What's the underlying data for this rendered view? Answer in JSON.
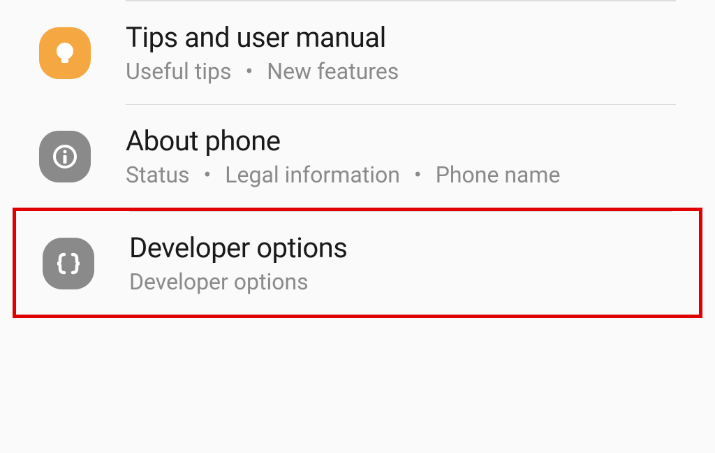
{
  "items": [
    {
      "title": "Tips and user manual",
      "subtitle_parts": [
        "Useful tips",
        "New features"
      ]
    },
    {
      "title": "About phone",
      "subtitle_parts": [
        "Status",
        "Legal information",
        "Phone name"
      ]
    },
    {
      "title": "Developer options",
      "subtitle_parts": [
        "Developer options"
      ]
    }
  ],
  "separator": "•"
}
